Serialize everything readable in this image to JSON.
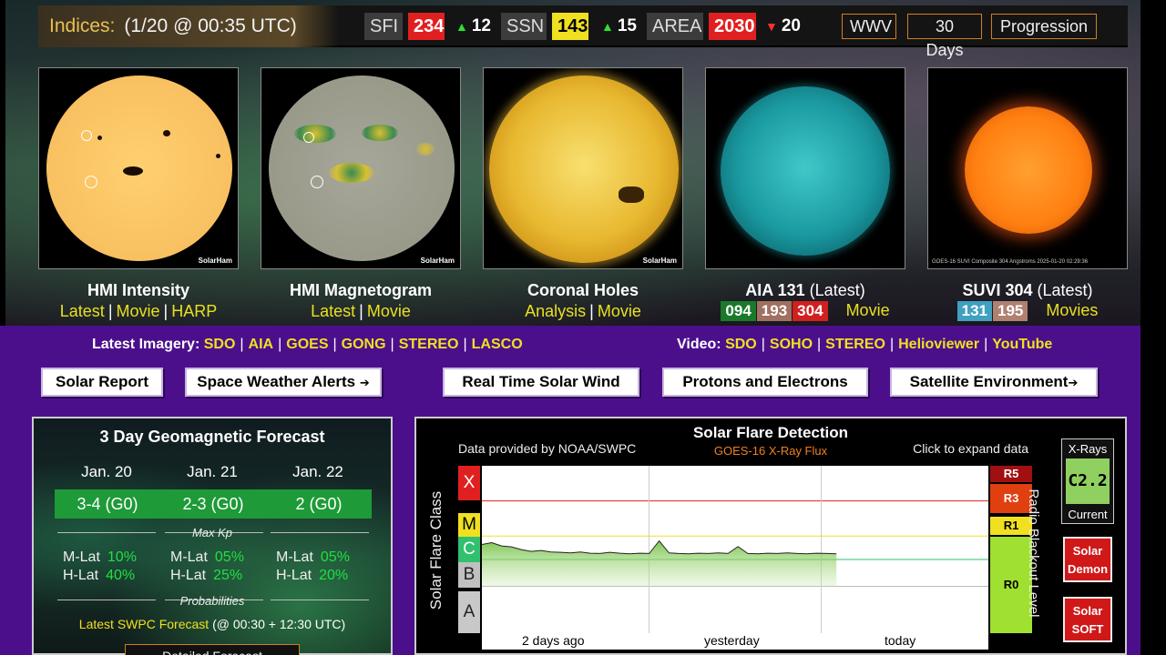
{
  "indices": {
    "label": "Indices:",
    "time": "(1/20 @ 00:35 UTC)",
    "sfi_name": "SFI",
    "sfi_value": "234",
    "sfi_delta": "12",
    "ssn_name": "SSN",
    "ssn_value": "143",
    "ssn_delta": "15",
    "area_name": "AREA",
    "area_value": "2030",
    "area_delta": "20",
    "links": [
      "WWV",
      "30 Days",
      "Progression"
    ]
  },
  "suns": [
    {
      "title": "HMI Intensity",
      "links": [
        "Latest",
        "Movie",
        "HARP"
      ],
      "tag": "SolarHam"
    },
    {
      "title": "HMI Magnetogram",
      "links": [
        "Latest",
        "Movie"
      ],
      "tag": "SolarHam"
    },
    {
      "title": "Coronal Holes",
      "links": [
        "Analysis",
        "Movie"
      ],
      "tag": "SolarHam"
    },
    {
      "title": "AIA 131",
      "title_suffix": "(Latest)",
      "wavelengths": [
        "094",
        "193",
        "304"
      ],
      "movie": "Movie"
    },
    {
      "title": "SUVI 304",
      "title_suffix": "(Latest)",
      "wavelengths": [
        "131",
        "195"
      ],
      "movie": "Movies",
      "caption": "GOES-16 SUVI Composite 304 Angstroms 2025-01-20 02:29:36"
    }
  ],
  "colors": {
    "w094": "#1a7a2a",
    "w193": "#a07060",
    "w304": "#d02020",
    "w131": "#40a0c0",
    "w195": "#b08070"
  },
  "imagery": {
    "label": "Latest Imagery:",
    "links": [
      "SDO",
      "AIA",
      "GOES",
      "GONG",
      "STEREO",
      "LASCO"
    ],
    "video_label": "Video:",
    "video_links": [
      "SDO",
      "SOHO",
      "STEREO",
      "Helioviewer",
      "YouTube"
    ]
  },
  "buttons": {
    "solar_report": "Solar Report",
    "alerts": "Space Weather Alerts",
    "wind": "Real Time Solar Wind",
    "protons": "Protons and Electrons",
    "satellite": "Satellite Environment"
  },
  "geo": {
    "title": "3 Day Geomagnetic Forecast",
    "days": [
      {
        "date": "Jan. 20",
        "kp": "3-4 (G0)",
        "mlat": "10%",
        "hlat": "40%"
      },
      {
        "date": "Jan. 21",
        "kp": "2-3 (G0)",
        "mlat": "05%",
        "hlat": "25%"
      },
      {
        "date": "Jan. 22",
        "kp": "2 (G0)",
        "mlat": "05%",
        "hlat": "20%"
      }
    ],
    "max_kp": "Max Kp",
    "mlat_label": "M-Lat",
    "hlat_label": "H-Lat",
    "probabilities": "Probabilities",
    "swpc_link": "Latest SWPC Forecast",
    "swpc_time": "(@ 00:30 + 12:30 UTC)",
    "detailed": "Detailed Forecast"
  },
  "flare": {
    "title": "Solar Flare Detection",
    "provider": "Data provided by NOAA/SWPC",
    "source": "GOES-16 X-Ray Flux",
    "expand": "Click to expand data",
    "y_label": "Solar Flare Class",
    "right_label": "Radio Blackout Level",
    "classes": [
      "X",
      "M",
      "C",
      "B",
      "A"
    ],
    "x_labels": [
      "2 days ago",
      "yesterday",
      "today"
    ],
    "r_levels": [
      "R5",
      "R3",
      "R1",
      "R0"
    ],
    "xray_label": "X-Rays",
    "xray_value": "C2.2",
    "xray_current": "Current",
    "demon_label": [
      "Solar",
      "Demon"
    ],
    "soft_label": [
      "Solar",
      "SOFT"
    ]
  },
  "chart_data": {
    "type": "area",
    "series": [
      {
        "x": [
          0,
          2,
          4,
          6,
          8,
          10,
          12,
          14,
          16,
          18,
          20,
          22,
          24,
          26,
          28,
          30,
          32,
          34,
          36,
          38,
          40,
          42,
          44,
          46,
          48,
          50,
          52,
          54,
          56,
          58,
          60,
          62,
          64,
          66,
          68,
          70,
          72
        ],
        "y": [
          0.5,
          0.56,
          0.45,
          0.42,
          0.33,
          0.27,
          0.3,
          0.25,
          0.24,
          0.22,
          0.25,
          0.21,
          0.2,
          0.24,
          0.21,
          0.19,
          0.21,
          0.2,
          0.62,
          0.22,
          0.2,
          0.19,
          0.21,
          0.2,
          0.22,
          0.2,
          0.43,
          0.2,
          0.19,
          0.21,
          0.2,
          0.22,
          0.2,
          0.19,
          0.21,
          0.2,
          0.19
        ]
      }
    ]
  }
}
